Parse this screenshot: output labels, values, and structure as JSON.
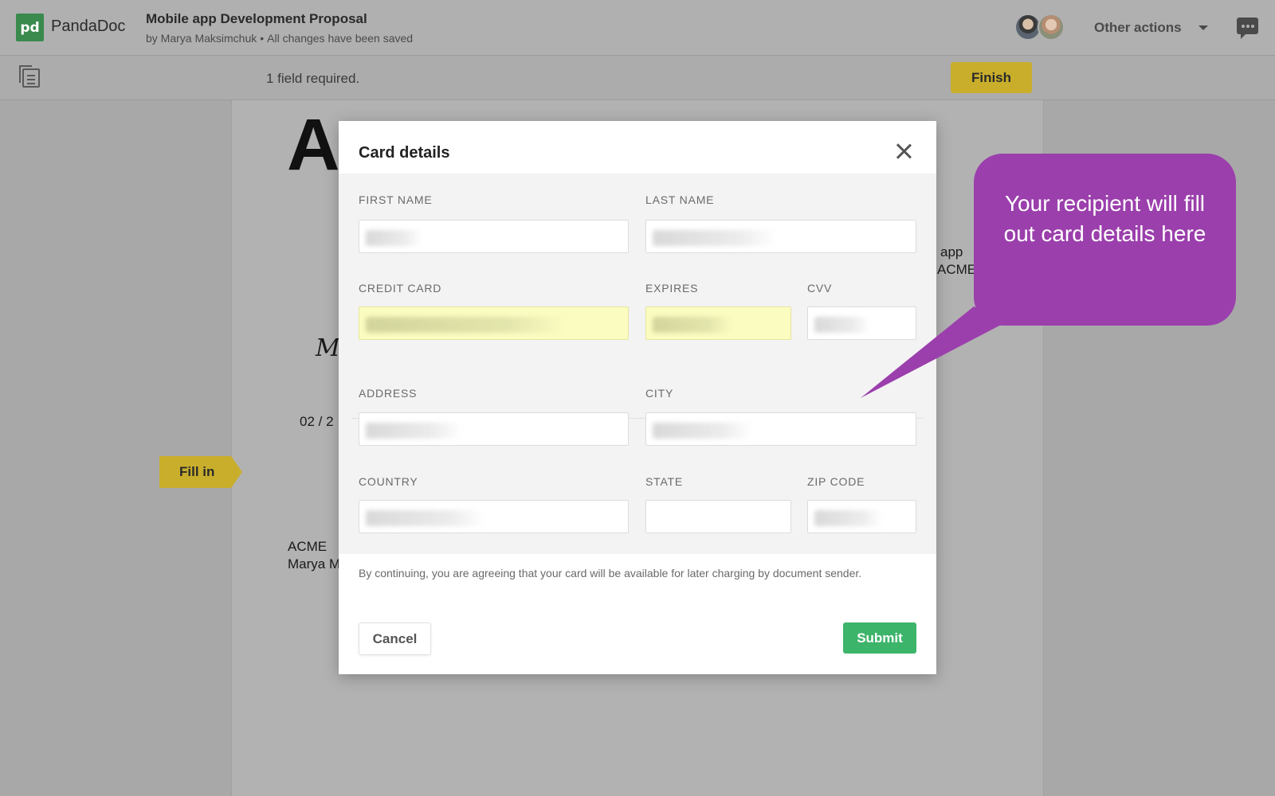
{
  "app": {
    "logo_text": "pd",
    "brand": "PandaDoc"
  },
  "document": {
    "title": "Mobile app Development Proposal",
    "author": "by Marya Maksimchuk",
    "save_status": "All changes have been saved",
    "heading_fragment": "A",
    "signature_fragment": "Ma",
    "date_fragment": "02 / 2",
    "company": "ACME",
    "person_fragment": "Marya M",
    "right_fragment_1": "app",
    "right_fragment_2": "ACME"
  },
  "header": {
    "other_actions": "Other actions"
  },
  "toolbar": {
    "required_text": "1 field required.",
    "finish_label": "Finish"
  },
  "fill_in_label": "Fill in",
  "modal": {
    "title": "Card details",
    "fields": {
      "first_name": "FIRST NAME",
      "last_name": "LAST NAME",
      "credit_card": "CREDIT CARD",
      "expires": "EXPIRES",
      "cvv": "CVV",
      "address": "ADDRESS",
      "city": "CITY",
      "country": "COUNTRY",
      "state": "STATE",
      "zip_code": "ZIP CODE"
    },
    "consent": "By continuing, you are agreeing that your card will be available for later charging by document sender.",
    "cancel_label": "Cancel",
    "submit_label": "Submit"
  },
  "callout": {
    "text": "Your recipient will fill out card details here",
    "color": "#9b3fac"
  },
  "colors": {
    "accent_yellow": "#c9ae2c",
    "submit_green": "#3cb46a",
    "highlight_field": "#fbfcc0"
  },
  "icons": [
    "pages-icon",
    "chevron-down-icon",
    "chat-icon",
    "close-icon",
    "avatar"
  ]
}
